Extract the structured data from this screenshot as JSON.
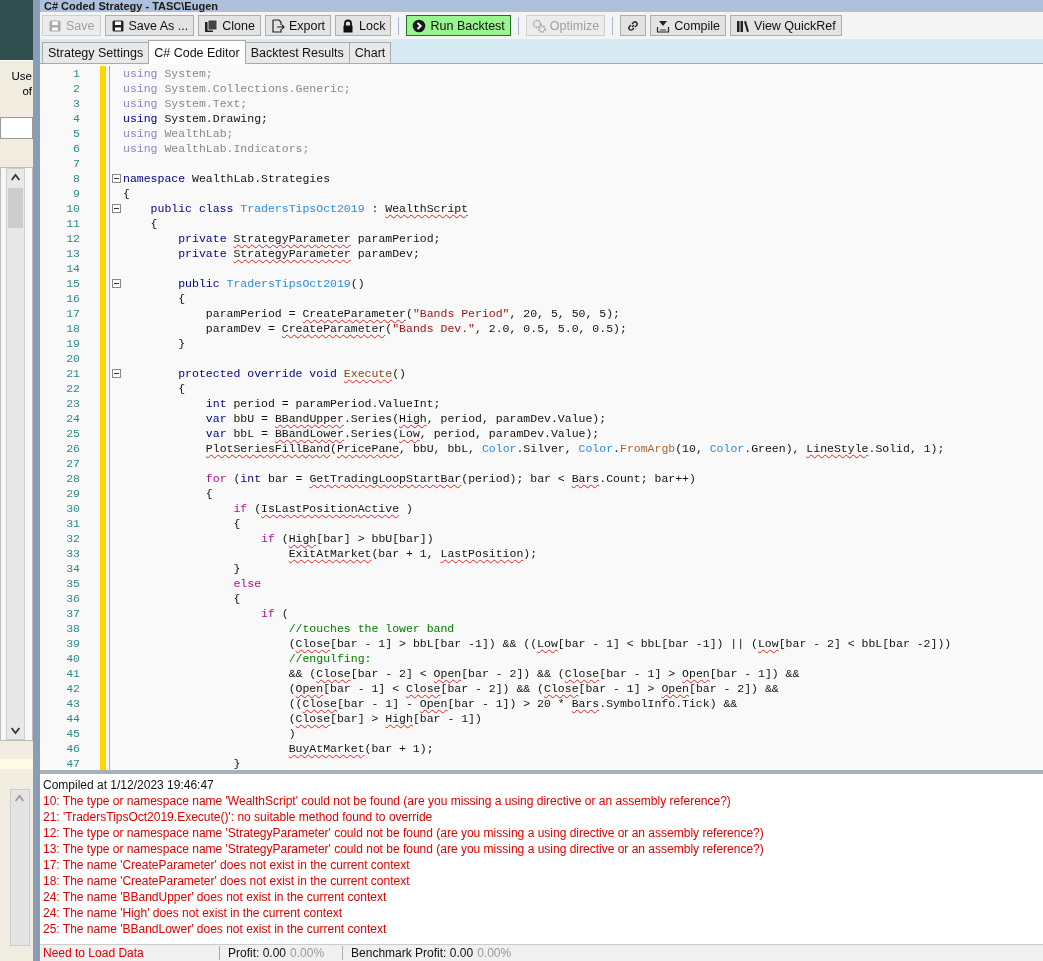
{
  "window": {
    "title": "C# Coded Strategy - TASC\\Eugen"
  },
  "side_panel": {
    "texts": [
      "Use",
      "of"
    ]
  },
  "toolbar": {
    "groups": [
      [
        {
          "label": "Save",
          "disabled": true,
          "highlighted": false
        },
        {
          "label": "Save As ...",
          "disabled": false,
          "highlighted": false
        },
        {
          "label": "Clone",
          "disabled": false,
          "highlighted": false
        },
        {
          "label": "Export",
          "disabled": false,
          "highlighted": false
        },
        {
          "label": "Lock",
          "disabled": false,
          "highlighted": false
        }
      ],
      [
        {
          "label": "Run Backtest",
          "disabled": false,
          "highlighted": true
        }
      ],
      [
        {
          "label": "Optimize",
          "disabled": true,
          "highlighted": false
        }
      ],
      [
        {
          "disabled": false,
          "highlighted": false
        },
        {
          "label": "Compile",
          "disabled": false,
          "highlighted": false
        },
        {
          "label": "View QuickRef",
          "disabled": false,
          "highlighted": false
        }
      ]
    ]
  },
  "tabs": [
    {
      "label": "Strategy Settings",
      "selected": false
    },
    {
      "label": "C# Code Editor",
      "selected": true
    },
    {
      "label": "Backtest Results",
      "selected": false
    },
    {
      "label": "Chart",
      "selected": false
    }
  ],
  "editor": {
    "lines": [
      {
        "number": "1",
        "fold": false,
        "tokens": [
          {
            "t": "using",
            "kind": "dimkw"
          },
          {
            "t": " System;",
            "kind": "dim"
          }
        ]
      },
      {
        "number": "2",
        "fold": false,
        "tokens": [
          {
            "t": "using",
            "kind": "dimkw"
          },
          {
            "t": " System.Collections.Generic;",
            "kind": "dim"
          }
        ]
      },
      {
        "number": "3",
        "fold": false,
        "tokens": [
          {
            "t": "using",
            "kind": "dimkw"
          },
          {
            "t": " System.Text;",
            "kind": "dim"
          }
        ]
      },
      {
        "number": "4",
        "fold": false,
        "tokens": [
          {
            "t": "using",
            "kind": "kw"
          },
          {
            "t": " System.Drawing;",
            "kind": "plain"
          }
        ]
      },
      {
        "number": "5",
        "fold": false,
        "tokens": [
          {
            "t": "using",
            "kind": "dimkw"
          },
          {
            "t": " WealthLab;",
            "kind": "dim"
          }
        ]
      },
      {
        "number": "6",
        "fold": false,
        "tokens": [
          {
            "t": "using",
            "kind": "dimkw"
          },
          {
            "t": " WealthLab.Indicators;",
            "kind": "dim"
          }
        ]
      },
      {
        "number": "7",
        "fold": false
      },
      {
        "number": "8",
        "fold": true,
        "tokens": [
          {
            "t": "namespace",
            "kind": "kw"
          },
          {
            "t": " WealthLab.Strategies",
            "kind": "plain"
          }
        ]
      },
      {
        "number": "9",
        "fold": false,
        "tokens": [
          {
            "t": "{",
            "kind": "plain"
          }
        ]
      },
      {
        "number": "10",
        "fold": true,
        "tokens": [
          {
            "t": "    public class ",
            "kind": "kw"
          },
          {
            "t": "TradersTipsOct2019",
            "kind": "type"
          },
          {
            "t": " : ",
            "kind": "plain"
          },
          {
            "t": "WealthScript",
            "kind": "err"
          }
        ]
      },
      {
        "number": "11",
        "fold": false,
        "tokens": [
          {
            "t": "    {",
            "kind": "plain"
          }
        ]
      },
      {
        "number": "12",
        "fold": false,
        "tokens": [
          {
            "t": "        private ",
            "kind": "kw"
          },
          {
            "t": "StrategyParameter",
            "kind": "err"
          },
          {
            "t": " paramPeriod;",
            "kind": "plain"
          }
        ]
      },
      {
        "number": "13",
        "fold": false,
        "tokens": [
          {
            "t": "        private ",
            "kind": "kw"
          },
          {
            "t": "StrategyParameter",
            "kind": "err"
          },
          {
            "t": " paramDev;",
            "kind": "plain"
          }
        ]
      },
      {
        "number": "14",
        "fold": false
      },
      {
        "number": "15",
        "fold": true,
        "tokens": [
          {
            "t": "        public ",
            "kind": "kw"
          },
          {
            "t": "TradersTipsOct2019",
            "kind": "type"
          },
          {
            "t": "()",
            "kind": "plain"
          }
        ]
      },
      {
        "number": "16",
        "fold": false,
        "tokens": [
          {
            "t": "        {",
            "kind": "plain"
          }
        ]
      },
      {
        "number": "17",
        "fold": false,
        "tokens": [
          {
            "t": "            paramPeriod = ",
            "kind": "plain"
          },
          {
            "t": "CreateParameter",
            "kind": "err"
          },
          {
            "t": "(",
            "kind": "plain"
          },
          {
            "t": "\"Bands Period\"",
            "kind": "str"
          },
          {
            "t": ", 20, 5, 50, 5);",
            "kind": "plain"
          }
        ]
      },
      {
        "number": "18",
        "fold": false,
        "tokens": [
          {
            "t": "            paramDev = ",
            "kind": "plain"
          },
          {
            "t": "CreateParameter",
            "kind": "err"
          },
          {
            "t": "(",
            "kind": "plain"
          },
          {
            "t": "\"Bands Dev.\"",
            "kind": "str"
          },
          {
            "t": ", 2.0, 0.5, 5.0, 0.5);",
            "kind": "plain"
          }
        ]
      },
      {
        "number": "19",
        "fold": false,
        "tokens": [
          {
            "t": "        }",
            "kind": "plain"
          }
        ]
      },
      {
        "number": "20",
        "fold": false
      },
      {
        "number": "21",
        "fold": true,
        "tokens": [
          {
            "t": "        protected override void ",
            "kind": "kw"
          },
          {
            "t": "Execute",
            "kind": "errmethod"
          },
          {
            "t": "()",
            "kind": "plain"
          }
        ]
      },
      {
        "number": "22",
        "fold": false,
        "tokens": [
          {
            "t": "        {",
            "kind": "plain"
          }
        ]
      },
      {
        "number": "23",
        "fold": false,
        "tokens": [
          {
            "t": "            int",
            "kind": "kw"
          },
          {
            "t": " period = paramPeriod.ValueInt;",
            "kind": "plain"
          }
        ]
      },
      {
        "number": "24",
        "fold": false,
        "tokens": [
          {
            "t": "            var",
            "kind": "kw"
          },
          {
            "t": " bbU = ",
            "kind": "plain"
          },
          {
            "t": "BBandUpper",
            "kind": "err"
          },
          {
            "t": ".Series(",
            "kind": "plain"
          },
          {
            "t": "High",
            "kind": "err"
          },
          {
            "t": ", period, paramDev.Value);",
            "kind": "plain"
          }
        ]
      },
      {
        "number": "25",
        "fold": false,
        "tokens": [
          {
            "t": "            var",
            "kind": "kw"
          },
          {
            "t": " bbL = ",
            "kind": "plain"
          },
          {
            "t": "BBandLower",
            "kind": "err"
          },
          {
            "t": ".Series(",
            "kind": "plain"
          },
          {
            "t": "Low",
            "kind": "err"
          },
          {
            "t": ", period, paramDev.Value);",
            "kind": "plain"
          }
        ]
      },
      {
        "number": "26",
        "fold": false,
        "tokens": [
          {
            "t": "            PlotSeriesFillBand",
            "kind": "err"
          },
          {
            "t": "(",
            "kind": "plain"
          },
          {
            "t": "PricePane",
            "kind": "err"
          },
          {
            "t": ", bbU, bbL, ",
            "kind": "plain"
          },
          {
            "t": "Color",
            "kind": "type"
          },
          {
            "t": ".Silver, ",
            "kind": "plain"
          },
          {
            "t": "Color",
            "kind": "type"
          },
          {
            "t": ".",
            "kind": "plain"
          },
          {
            "t": "FromArgb",
            "kind": "method"
          },
          {
            "t": "(10, ",
            "kind": "plain"
          },
          {
            "t": "Color",
            "kind": "type"
          },
          {
            "t": ".Green), ",
            "kind": "plain"
          },
          {
            "t": "LineStyle",
            "kind": "err"
          },
          {
            "t": ".Solid, 1);",
            "kind": "plain"
          }
        ]
      },
      {
        "number": "27",
        "fold": false
      },
      {
        "number": "28",
        "fold": false,
        "tokens": [
          {
            "t": "            for",
            "kind": "ctl"
          },
          {
            "t": " (",
            "kind": "plain"
          },
          {
            "t": "int",
            "kind": "kw"
          },
          {
            "t": " bar = ",
            "kind": "plain"
          },
          {
            "t": "GetTradingLoopStartBar",
            "kind": "err"
          },
          {
            "t": "(period); bar < ",
            "kind": "plain"
          },
          {
            "t": "Bars",
            "kind": "err"
          },
          {
            "t": ".Count; bar++)",
            "kind": "plain"
          }
        ]
      },
      {
        "number": "29",
        "fold": false,
        "tokens": [
          {
            "t": "            {",
            "kind": "plain"
          }
        ]
      },
      {
        "number": "30",
        "fold": false,
        "tokens": [
          {
            "t": "                if",
            "kind": "ctl"
          },
          {
            "t": " (",
            "kind": "plain"
          },
          {
            "t": "IsLastPositionActive",
            "kind": "err"
          },
          {
            "t": " )",
            "kind": "plain"
          }
        ]
      },
      {
        "number": "31",
        "fold": false,
        "tokens": [
          {
            "t": "                {",
            "kind": "plain"
          }
        ]
      },
      {
        "number": "32",
        "fold": false,
        "tokens": [
          {
            "t": "                    if",
            "kind": "ctl"
          },
          {
            "t": " (",
            "kind": "plain"
          },
          {
            "t": "High",
            "kind": "err"
          },
          {
            "t": "[bar] > bbU[bar])",
            "kind": "plain"
          }
        ]
      },
      {
        "number": "33",
        "fold": false,
        "tokens": [
          {
            "t": "                        ExitAtMarket",
            "kind": "err"
          },
          {
            "t": "(bar + 1, ",
            "kind": "plain"
          },
          {
            "t": "LastPosition",
            "kind": "err"
          },
          {
            "t": ");",
            "kind": "plain"
          }
        ]
      },
      {
        "number": "34",
        "fold": false,
        "tokens": [
          {
            "t": "                }",
            "kind": "plain"
          }
        ]
      },
      {
        "number": "35",
        "fold": false,
        "tokens": [
          {
            "t": "                else",
            "kind": "ctl"
          }
        ]
      },
      {
        "number": "36",
        "fold": false,
        "tokens": [
          {
            "t": "                {",
            "kind": "plain"
          }
        ]
      },
      {
        "number": "37",
        "fold": false,
        "tokens": [
          {
            "t": "                    if",
            "kind": "ctl"
          },
          {
            "t": " (",
            "kind": "plain"
          }
        ]
      },
      {
        "number": "38",
        "fold": false,
        "tokens": [
          {
            "t": "                        //touches the lower band",
            "kind": "cmt"
          }
        ]
      },
      {
        "number": "39",
        "fold": false,
        "tokens": [
          {
            "t": "                        (",
            "kind": "plain"
          },
          {
            "t": "Close",
            "kind": "err"
          },
          {
            "t": "[bar - 1] > bbL[bar -1]) && ((",
            "kind": "plain"
          },
          {
            "t": "Low",
            "kind": "err"
          },
          {
            "t": "[bar - 1] < bbL[bar -1]) || (",
            "kind": "plain"
          },
          {
            "t": "Low",
            "kind": "err"
          },
          {
            "t": "[bar - 2] < bbL[bar -2]))",
            "kind": "plain"
          }
        ]
      },
      {
        "number": "40",
        "fold": false,
        "tokens": [
          {
            "t": "                        //engulfing:",
            "kind": "cmt"
          }
        ]
      },
      {
        "number": "41",
        "fold": false,
        "tokens": [
          {
            "t": "                        && (",
            "kind": "plain"
          },
          {
            "t": "Close",
            "kind": "err"
          },
          {
            "t": "[bar - 2] < ",
            "kind": "plain"
          },
          {
            "t": "Open",
            "kind": "err"
          },
          {
            "t": "[bar - 2]) && (",
            "kind": "plain"
          },
          {
            "t": "Close",
            "kind": "err"
          },
          {
            "t": "[bar - 1] > ",
            "kind": "plain"
          },
          {
            "t": "Open",
            "kind": "err"
          },
          {
            "t": "[bar - 1]) &&",
            "kind": "plain"
          }
        ]
      },
      {
        "number": "42",
        "fold": false,
        "tokens": [
          {
            "t": "                        (",
            "kind": "plain"
          },
          {
            "t": "Open",
            "kind": "err"
          },
          {
            "t": "[bar - 1] < ",
            "kind": "plain"
          },
          {
            "t": "Close",
            "kind": "err"
          },
          {
            "t": "[bar - 2]) && (",
            "kind": "plain"
          },
          {
            "t": "Close",
            "kind": "err"
          },
          {
            "t": "[bar - 1] > ",
            "kind": "plain"
          },
          {
            "t": "Open",
            "kind": "err"
          },
          {
            "t": "[bar - 2]) &&",
            "kind": "plain"
          }
        ]
      },
      {
        "number": "43",
        "fold": false,
        "tokens": [
          {
            "t": "                        ((",
            "kind": "plain"
          },
          {
            "t": "Close",
            "kind": "err"
          },
          {
            "t": "[bar - 1] - ",
            "kind": "plain"
          },
          {
            "t": "Open",
            "kind": "err"
          },
          {
            "t": "[bar - 1]) > 20 * ",
            "kind": "plain"
          },
          {
            "t": "Bars",
            "kind": "err"
          },
          {
            "t": ".SymbolInfo.Tick) &&",
            "kind": "plain"
          }
        ]
      },
      {
        "number": "44",
        "fold": false,
        "tokens": [
          {
            "t": "                        (",
            "kind": "plain"
          },
          {
            "t": "Close",
            "kind": "err"
          },
          {
            "t": "[bar] > ",
            "kind": "plain"
          },
          {
            "t": "High",
            "kind": "err"
          },
          {
            "t": "[bar - 1])",
            "kind": "plain"
          }
        ]
      },
      {
        "number": "45",
        "fold": false,
        "tokens": [
          {
            "t": "                        )",
            "kind": "plain"
          }
        ]
      },
      {
        "number": "46",
        "fold": false,
        "tokens": [
          {
            "t": "                        BuyAtMarket",
            "kind": "err"
          },
          {
            "t": "(bar + 1);",
            "kind": "plain"
          }
        ]
      },
      {
        "number": "47",
        "fold": false,
        "tokens": [
          {
            "t": "                }",
            "kind": "plain"
          }
        ]
      }
    ]
  },
  "output": {
    "messages": [
      {
        "kind": "info",
        "text": "Compiled at 1/12/2023 19:46:47"
      },
      {
        "kind": "error",
        "text": "10: The type or namespace name 'WealthScript' could not be found (are you missing a using directive or an assembly reference?)"
      },
      {
        "kind": "error",
        "text": "21: 'TradersTipsOct2019.Execute()': no suitable method found to override"
      },
      {
        "kind": "error",
        "text": "12: The type or namespace name 'StrategyParameter' could not be found (are you missing a using directive or an assembly reference?)"
      },
      {
        "kind": "error",
        "text": "13: The type or namespace name 'StrategyParameter' could not be found (are you missing a using directive or an assembly reference?)"
      },
      {
        "kind": "error",
        "text": "17: The name 'CreateParameter' does not exist in the current context"
      },
      {
        "kind": "error",
        "text": "18: The name 'CreateParameter' does not exist in the current context"
      },
      {
        "kind": "error",
        "text": "24: The name 'BBandUpper' does not exist in the current context"
      },
      {
        "kind": "error",
        "text": "24: The name 'High' does not exist in the current context"
      },
      {
        "kind": "error",
        "text": "25: The name 'BBandLower' does not exist in the current context"
      }
    ]
  },
  "status_bar": {
    "data_status": "Need to Load Data",
    "profit": "Profit: 0.00",
    "profit_pct": "0.00%",
    "benchmark": "Benchmark Profit: 0.00",
    "benchmark_pct": "0.00%"
  }
}
